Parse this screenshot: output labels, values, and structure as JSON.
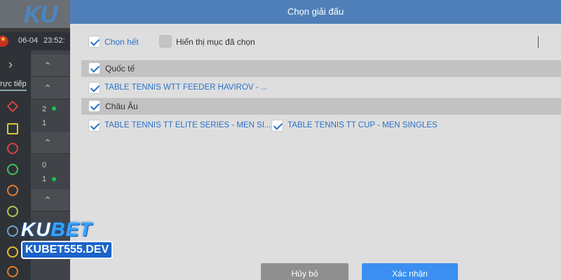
{
  "background": {
    "logo_text": "KU",
    "date": "06-04",
    "time": "23:52:",
    "nav_arrow": "›",
    "live_label": "Trực tiếp",
    "scores": [
      "2",
      "1",
      "0",
      "1"
    ]
  },
  "watermark": {
    "brand_ku": "KU",
    "brand_bet": "BET",
    "site": "KUBET555.DEV"
  },
  "modal": {
    "title": "Chọn giải đấu",
    "select_all_label": "Chọn hết",
    "select_all_checked": true,
    "show_selected_label": "Hiển thị mục đã chọn",
    "show_selected_checked": false,
    "groups": [
      {
        "name": "Quốc tế",
        "checked": true,
        "leagues": [
          {
            "label": "TABLE TENNIS WTT FEEDER HAVIROV - ...",
            "checked": true
          }
        ]
      },
      {
        "name": "Châu Âu",
        "checked": true,
        "leagues": [
          {
            "label": "TABLE TENNIS TT ELITE SERIES - MEN SI...",
            "checked": true
          },
          {
            "label": "TABLE TENNIS TT CUP - MEN SINGLES",
            "checked": true
          }
        ]
      }
    ],
    "cancel_label": "Hủy bỏ",
    "confirm_label": "Xác nhận"
  },
  "colors": {
    "header": "#4f7fb8",
    "accent": "#2b72c8",
    "confirm": "#3b8ff0",
    "cancel": "#8f8f8f"
  }
}
